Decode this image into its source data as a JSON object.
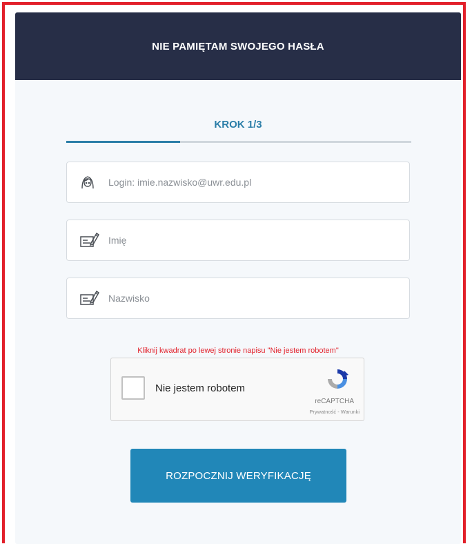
{
  "header": {
    "title": "NIE PAMIĘTAM SWOJEGO HASŁA"
  },
  "step": {
    "label": "KROK 1/3",
    "progress": 0.33
  },
  "fields": {
    "login": {
      "placeholder": "Login: imie.nazwisko@uwr.edu.pl",
      "value": ""
    },
    "first_name": {
      "placeholder": "Imię",
      "value": ""
    },
    "last_name": {
      "placeholder": "Nazwisko",
      "value": ""
    }
  },
  "captcha": {
    "hint": "Kliknij kwadrat po lewej stronie napisu \"Nie jestem robotem\"",
    "label": "Nie jestem robotem",
    "brand": "reCAPTCHA",
    "links": "Prywatność - Warunki"
  },
  "submit": {
    "label": "ROZPOCZNIJ WERYFIKACJĘ"
  },
  "colors": {
    "header_bg": "#272e47",
    "accent": "#2b7ea8",
    "button": "#2187b8",
    "warning": "#e2202a"
  }
}
